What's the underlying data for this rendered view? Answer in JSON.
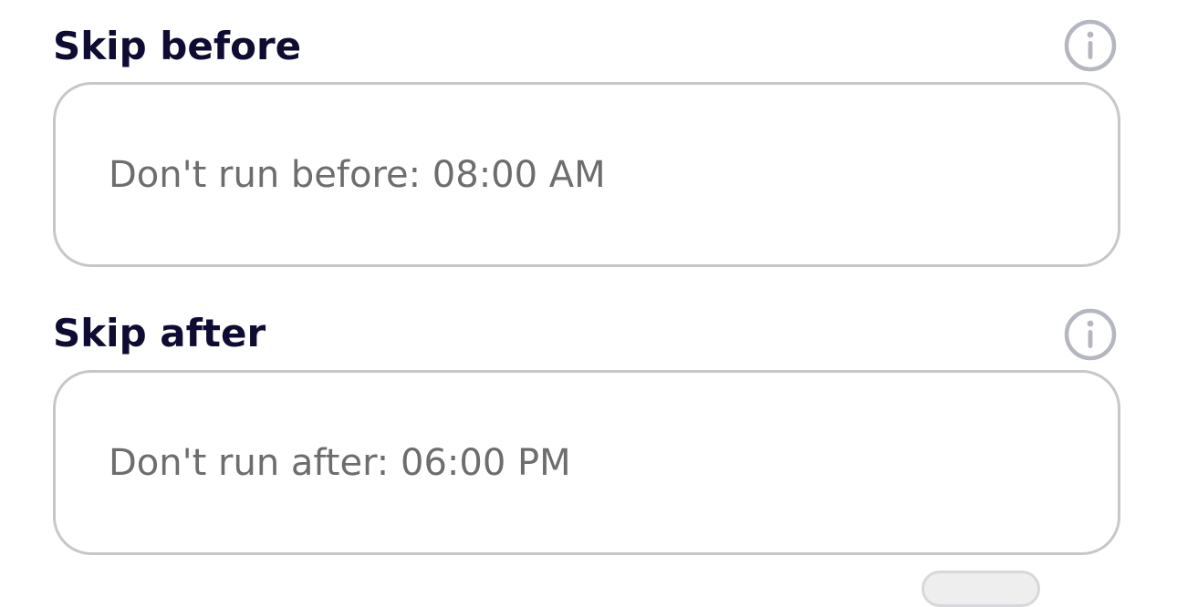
{
  "skip_before": {
    "label": "Skip before",
    "info_icon": "info-icon",
    "field_text": "Don't run before: 08:00 AM"
  },
  "skip_after": {
    "label": "Skip after",
    "info_icon": "info-icon",
    "field_text": "Don't run after: 06:00 PM"
  },
  "colors": {
    "label": "#0f0c33",
    "field_text": "#6d6d70",
    "field_border": "#c7c7c9",
    "info_icon": "#b4b6c0"
  }
}
